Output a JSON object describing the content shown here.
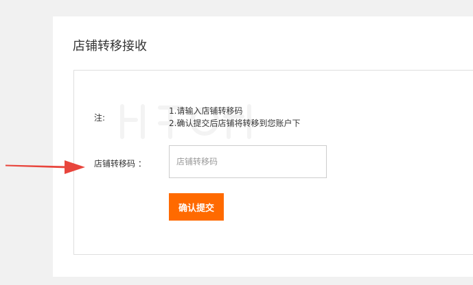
{
  "page": {
    "title": "店铺转移接收"
  },
  "notes": {
    "label": "注:",
    "lines": [
      "1.请输入店铺转移码",
      "2.确认提交后店铺将转移到您账户下"
    ]
  },
  "form": {
    "code_label": "店铺转移码 ：",
    "code_placeholder": "店铺转移码",
    "code_value": "",
    "submit_label": "确认提交"
  },
  "colors": {
    "accent": "#ff6a00",
    "annotation_arrow": "#e8453c",
    "background": "#f1f1f1"
  },
  "icons": {
    "annotation": "red-arrow-icon"
  }
}
